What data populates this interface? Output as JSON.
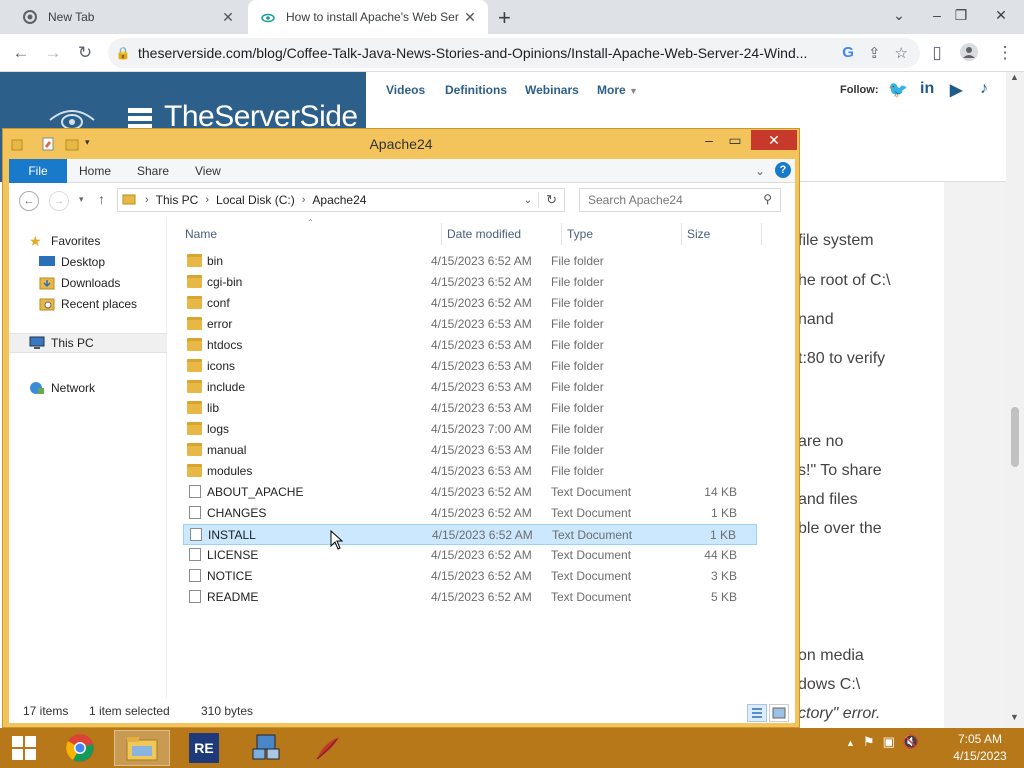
{
  "browser": {
    "tabs": [
      {
        "title": "New Tab",
        "active": false
      },
      {
        "title": "How to install Apache's Web Ser",
        "active": true
      }
    ],
    "url": "theserverside.com/blog/Coffee-Talk-Java-News-Stories-and-Opinions/Install-Apache-Web-Server-24-Wind..."
  },
  "site": {
    "logo": "TheServerSide",
    "nav": [
      "Videos",
      "Definitions",
      "Webinars",
      "More"
    ],
    "follow_label": "Follow:",
    "social": [
      "twitter-icon",
      "linkedin-icon",
      "youtube-icon",
      "tiktok-icon"
    ],
    "article_fragments": [
      "file system",
      "he root of C:\\",
      "nand",
      "t:80 to verify",
      "are no",
      "s!\" To share",
      "and files",
      "ble over the",
      "on media",
      "dows C:\\",
      "ctory\" error."
    ]
  },
  "explorer": {
    "title": "Apache24",
    "ribbon_tabs": [
      "File",
      "Home",
      "Share",
      "View"
    ],
    "breadcrumb": [
      "This PC",
      "Local Disk (C:)",
      "Apache24"
    ],
    "search_placeholder": "Search Apache24",
    "nav_pane": {
      "favorites_label": "Favorites",
      "favorites": [
        "Desktop",
        "Downloads",
        "Recent places"
      ],
      "this_pc": "This PC",
      "network": "Network"
    },
    "columns": [
      "Name",
      "Date modified",
      "Type",
      "Size"
    ],
    "files": [
      {
        "name": "bin",
        "date": "4/15/2023 6:52 AM",
        "type": "File folder",
        "size": ""
      },
      {
        "name": "cgi-bin",
        "date": "4/15/2023 6:52 AM",
        "type": "File folder",
        "size": ""
      },
      {
        "name": "conf",
        "date": "4/15/2023 6:52 AM",
        "type": "File folder",
        "size": ""
      },
      {
        "name": "error",
        "date": "4/15/2023 6:53 AM",
        "type": "File folder",
        "size": ""
      },
      {
        "name": "htdocs",
        "date": "4/15/2023 6:53 AM",
        "type": "File folder",
        "size": ""
      },
      {
        "name": "icons",
        "date": "4/15/2023 6:53 AM",
        "type": "File folder",
        "size": ""
      },
      {
        "name": "include",
        "date": "4/15/2023 6:53 AM",
        "type": "File folder",
        "size": ""
      },
      {
        "name": "lib",
        "date": "4/15/2023 6:53 AM",
        "type": "File folder",
        "size": ""
      },
      {
        "name": "logs",
        "date": "4/15/2023 7:00 AM",
        "type": "File folder",
        "size": ""
      },
      {
        "name": "manual",
        "date": "4/15/2023 6:53 AM",
        "type": "File folder",
        "size": ""
      },
      {
        "name": "modules",
        "date": "4/15/2023 6:53 AM",
        "type": "File folder",
        "size": ""
      },
      {
        "name": "ABOUT_APACHE",
        "date": "4/15/2023 6:52 AM",
        "type": "Text Document",
        "size": "14 KB"
      },
      {
        "name": "CHANGES",
        "date": "4/15/2023 6:52 AM",
        "type": "Text Document",
        "size": "1 KB"
      },
      {
        "name": "INSTALL",
        "date": "4/15/2023 6:52 AM",
        "type": "Text Document",
        "size": "1 KB",
        "selected": true
      },
      {
        "name": "LICENSE",
        "date": "4/15/2023 6:52 AM",
        "type": "Text Document",
        "size": "44 KB"
      },
      {
        "name": "NOTICE",
        "date": "4/15/2023 6:52 AM",
        "type": "Text Document",
        "size": "3 KB"
      },
      {
        "name": "README",
        "date": "4/15/2023 6:52 AM",
        "type": "Text Document",
        "size": "5 KB"
      }
    ],
    "status": {
      "item_count": "17 items",
      "selection": "1 item selected",
      "selection_size": "310 bytes"
    }
  },
  "taskbar": {
    "apps": [
      "start-button",
      "chrome-icon",
      "file-explorer-icon",
      "re-app-icon",
      "network-tool-icon",
      "feather-app-icon"
    ],
    "clock_time": "7:05 AM",
    "clock_date": "4/15/2023"
  },
  "colors": {
    "taskbar": "#b67819",
    "explorer_frame": "#f3c35c",
    "selection": "#cce8ff",
    "file_tab": "#1979ca",
    "site_header": "#2c5f8a"
  }
}
